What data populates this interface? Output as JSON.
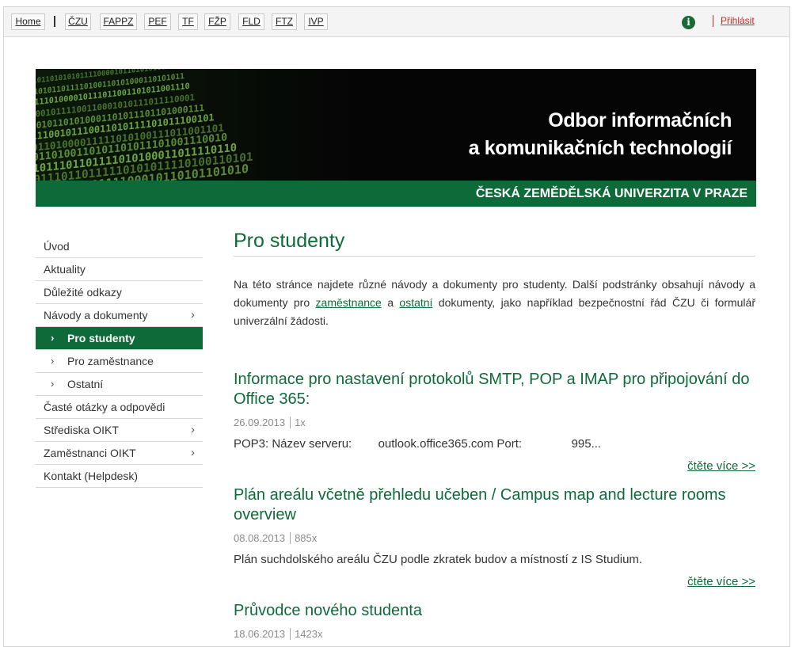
{
  "topbar": {
    "links": [
      "Home",
      "ČZU",
      "FAPPZ",
      "PEF",
      "TF",
      "FŽP",
      "FLD",
      "FTZ",
      "IVP"
    ],
    "info_icon": "info-icon",
    "login": "Přihlásit"
  },
  "banner": {
    "title_line1": "Odbor informačních",
    "title_line2": "a komunikačních technologií",
    "university": "ČESKÁ ZEMĚDĚLSKÁ UNIVERZITA V PRAZE",
    "binary_lines": [
      "0101011010101011110000101101010101110",
      "100101011011110100110101000110101011",
      "01011101000010111011001101011001110",
      "1100010111100110001010111011110001",
      "0110101101010001101011101101000111",
      "1011100101110011010111101011100101",
      "0101101000011111010100111011001101",
      "110110100110101101011101001110010",
      "011011101101111010100011011110110",
      "1101110110111110101011110100110101",
      "01101011010111100010110101101010"
    ]
  },
  "sidebar": {
    "items": [
      {
        "label": "Úvod",
        "chevron": false
      },
      {
        "label": "Aktuality",
        "chevron": false
      },
      {
        "label": "Důležité odkazy",
        "chevron": false
      },
      {
        "label": "Návody a dokumenty",
        "chevron": true
      },
      {
        "label": "Pro studenty",
        "sub": true,
        "active": true
      },
      {
        "label": "Pro zaměstnance",
        "sub": true
      },
      {
        "label": "Ostatní",
        "sub": true
      },
      {
        "label": "Časté otázky a odpovědi",
        "chevron": false
      },
      {
        "label": "Střediska OIKT",
        "chevron": true
      },
      {
        "label": "Zaměstnanci OIKT",
        "chevron": true
      },
      {
        "label": "Kontakt (Helpdesk)",
        "chevron": false
      }
    ]
  },
  "main": {
    "title": "Pro studenty",
    "intro_part1": "Na této stránce najdete různé návody a dokumenty pro studenty. Další podstránky obsahují návody a dokumenty pro ",
    "intro_link1": "zaměstnance",
    "intro_part2": " a ",
    "intro_link2": "ostatní",
    "intro_part3": " dokumenty, jako například bezpečnostní řád ČZU či formulář univerzální žádosti.",
    "articles": [
      {
        "title": "Informace pro nastavení protokolů SMTP, POP a IMAP pro připojování do Office 365:",
        "date": "26.09.2013",
        "views": "1x",
        "text": "POP3: Název serveru:        outlook.office365.com Port:               995...",
        "read_more": "čtěte více >>"
      },
      {
        "title": "Plán areálu včetně přehledu učeben / Campus map and lecture rooms overview",
        "date": "08.08.2013",
        "views": "885x",
        "text": "Plán suchdolského areálu ČZU podle zkratek budov a místností z IS Studium.",
        "read_more": "čtěte více >>"
      },
      {
        "title": "Průvodce nového studenta",
        "date": "18.06.2013",
        "views": "1423x"
      }
    ]
  },
  "colors": {
    "brand_green": "#0f6a3a",
    "login_red": "#b9302b",
    "binary_green": "#7fbd4f"
  }
}
